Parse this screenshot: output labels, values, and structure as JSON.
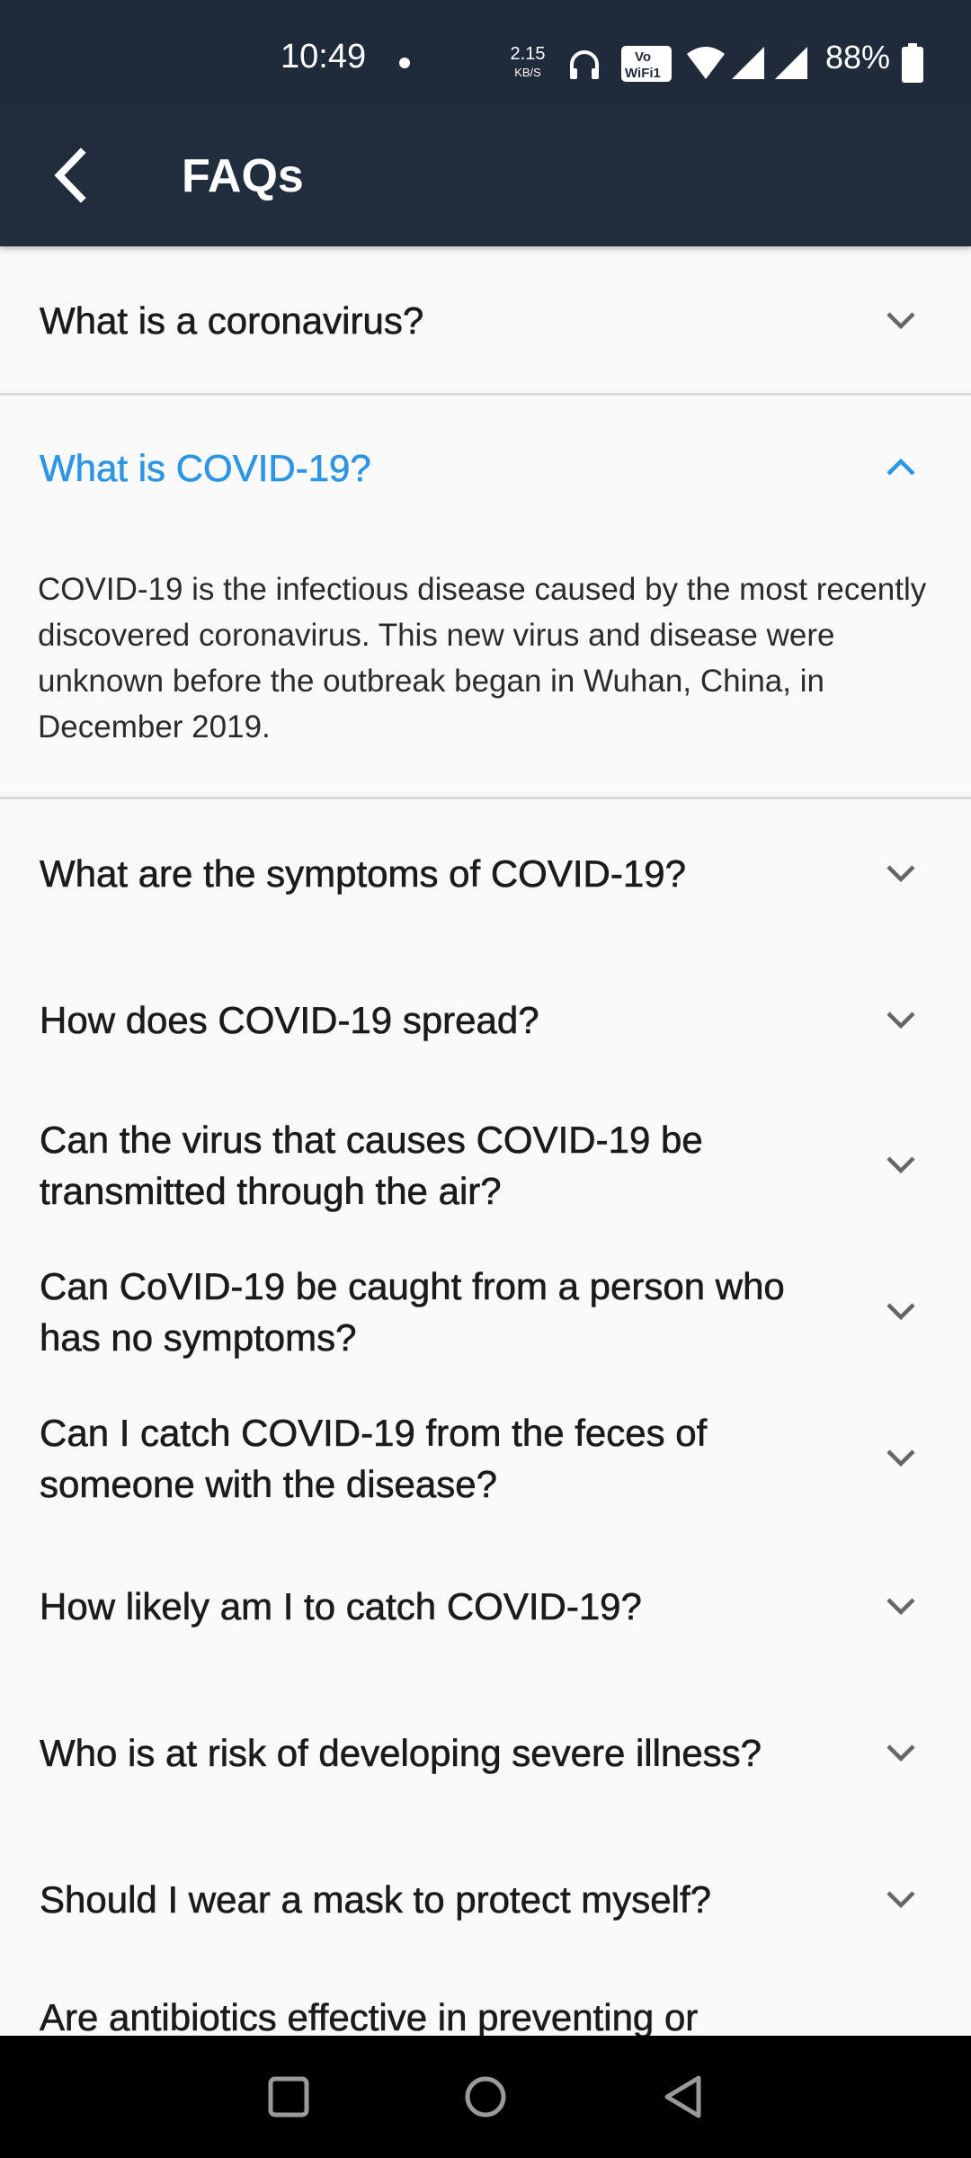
{
  "status_bar": {
    "time": "10:49",
    "net_speed": "2.15",
    "net_unit": "KB/S",
    "battery": "88%",
    "icons": [
      "dot-icon",
      "headphones-icon",
      "vowifi-icon",
      "wifi-icon",
      "signal-icon",
      "signal-icon",
      "battery-icon"
    ]
  },
  "app_bar": {
    "title": "FAQs",
    "back_icon": "back-arrow-icon"
  },
  "colors": {
    "status_bar_bg": "#1f2a3a",
    "app_bar_bg": "#202d3d",
    "accent": "#2d95e3",
    "background": "#f9f9f9"
  },
  "faqs": [
    {
      "question": "What is a coronavirus?",
      "expanded": false
    },
    {
      "question": "What is COVID-19?",
      "expanded": true,
      "answer": "COVID-19 is the infectious disease caused by the most recently discovered coronavirus. This new virus and disease were unknown before the outbreak began in Wuhan, China, in December 2019."
    },
    {
      "question": "What are the symptoms of COVID-19?",
      "expanded": false
    },
    {
      "question": "How does COVID-19 spread?",
      "expanded": false
    },
    {
      "question": "Can the virus that causes COVID-19 be transmitted through the air?",
      "expanded": false
    },
    {
      "question": "Can CoVID-19 be caught from a person who has no symptoms?",
      "expanded": false
    },
    {
      "question": "Can I catch COVID-19 from the feces of someone with the disease?",
      "expanded": false
    },
    {
      "question": "How likely am I to catch COVID-19?",
      "expanded": false
    },
    {
      "question": "Who is at risk of developing severe illness?",
      "expanded": false
    },
    {
      "question": "Should I wear a mask to protect myself?",
      "expanded": false
    },
    {
      "question": "Are antibiotics effective in preventing or",
      "expanded": false
    }
  ],
  "nav_bar": {
    "buttons": [
      "recents-square-icon",
      "home-circle-icon",
      "back-triangle-icon"
    ]
  }
}
